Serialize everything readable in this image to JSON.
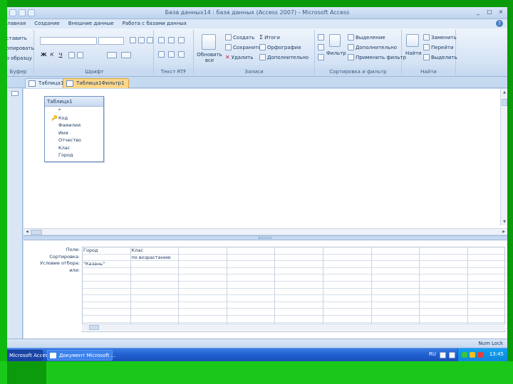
{
  "window": {
    "title": "База данных14 : база данных (Access 2007) - Microsoft Access",
    "buttons": [
      "_",
      "□",
      "×"
    ]
  },
  "menu": {
    "tabs": [
      "Главная",
      "Создание",
      "Внешние данные",
      "Работа с базами данных"
    ],
    "help": "?"
  },
  "ribbon": {
    "clipboard": {
      "items": [
        "Вставить",
        "Копировать",
        "по образцу"
      ],
      "label": "Буфер обмена"
    },
    "font": {
      "label": "Шрифт"
    },
    "rich_text": {
      "label": "Текст RTF"
    },
    "records": {
      "refresh": "Обновить все",
      "new": "Создать",
      "save": "Сохранить",
      "delete": "Удалить",
      "totals": "Итоги",
      "spelling": "Орфография",
      "more": "Дополнительно",
      "label": "Записи"
    },
    "sort_filter": {
      "filter": "Фильтр",
      "selection": "Выделение",
      "advanced": "Дополнительно",
      "toggle": "Применить фильтр",
      "label": "Сортировка и фильтр"
    },
    "find": {
      "find": "Найти",
      "replace": "Заменить",
      "goto": "Перейти",
      "select": "Выделить",
      "label": "Найти"
    }
  },
  "navpane": {
    "header": "»"
  },
  "doctabs": [
    {
      "label": "Таблица1",
      "active": false
    },
    {
      "label": "Таблица1Фильтр1",
      "active": true
    }
  ],
  "fieldlist": {
    "title": "Таблица1",
    "fields": [
      "*",
      "Код",
      "Фамилия",
      "Имя",
      "Отчество",
      "Клас",
      "Город"
    ],
    "key_field_index": 1
  },
  "query_grid": {
    "row_labels": [
      "Поле:",
      "Сортировка:",
      "Условие отбора:",
      "или:"
    ],
    "columns": [
      {
        "field": "Город",
        "sort": "",
        "criteria": "\"Казань\""
      },
      {
        "field": "Клас",
        "sort": "по возрастанию",
        "criteria": ""
      }
    ],
    "empty_columns": 7
  },
  "statusbar": {
    "numlock": "Num Lock"
  },
  "taskbar": {
    "items": [
      {
        "label": "Microsoft Access - Ба...",
        "active": true
      },
      {
        "label": "Документ Microsoft ...",
        "active": false
      }
    ],
    "language": "RU",
    "clock": "13:45"
  }
}
